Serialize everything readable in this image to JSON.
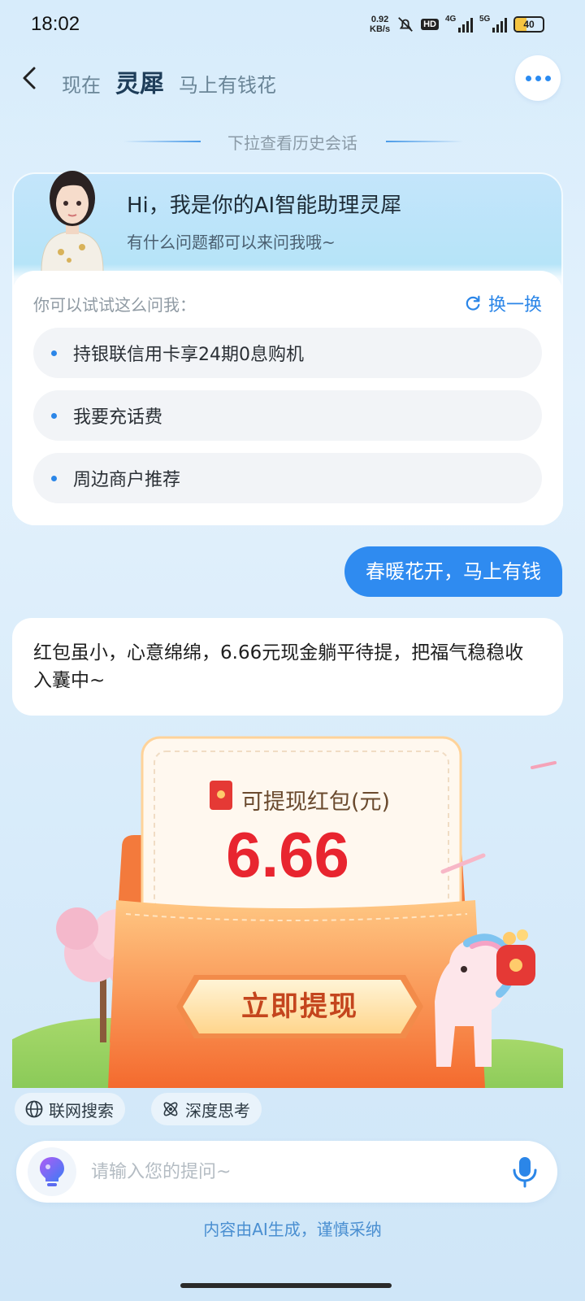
{
  "status_bar": {
    "time": "18:02",
    "net_speed_value": "0.92",
    "net_speed_unit": "KB/s",
    "hd_label": "HD",
    "sim1_label": "4G",
    "sim2_label": "5G",
    "battery": "40",
    "battery_level": 0.4,
    "icons": [
      "bell-off-icon",
      "signal-icon",
      "battery-icon"
    ]
  },
  "header": {
    "tabs": [
      {
        "label": "现在",
        "active": false
      },
      {
        "label": "灵犀",
        "active": true
      },
      {
        "label": "马上有钱花",
        "active": false
      }
    ]
  },
  "history_hint": "下拉查看历史会话",
  "welcome": {
    "title": "Hi，我是你的AI智能助理灵犀",
    "subtitle": "有什么问题都可以来问我哦~",
    "suggest_label": "你可以试试这么问我：",
    "refresh_label": "换一换",
    "suggestions": [
      "持银联信用卡享24期0息购机",
      "我要充话费",
      "周边商户推荐"
    ]
  },
  "chat": {
    "user_message": "春暖花开，马上有钱",
    "bot_reply": "红包虽小，心意绵绵，6.66元现金躺平待提，把福气稳稳收入囊中~"
  },
  "red_packet": {
    "label": "可提现红包(元)",
    "amount": "6.66",
    "button_label": "立即提现"
  },
  "tools": {
    "web_search": "联网搜索",
    "deep_think": "深度思考"
  },
  "input": {
    "placeholder": "请输入您的提问~"
  },
  "disclaimer": "内容由AI生成，谨慎采纳",
  "colors": {
    "accent": "#2f8bf0",
    "amount_red": "#e8252f",
    "packet_orange": "#f57c3a"
  }
}
